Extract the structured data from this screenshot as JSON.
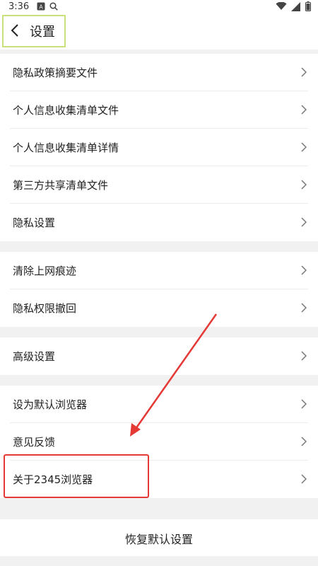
{
  "status_bar": {
    "time": "3:36",
    "icons": [
      "a-icon",
      "search-icon",
      "wifi-icon",
      "battery-icon"
    ]
  },
  "header": {
    "title": "设置",
    "back_icon": "chevron-left-icon",
    "highlight_color": "#c9e07e"
  },
  "groups": [
    {
      "items": [
        {
          "label": "隐私政策摘要文件"
        },
        {
          "label": "个人信息收集清单文件"
        },
        {
          "label": "个人信息收集清单详情"
        },
        {
          "label": "第三方共享清单文件"
        },
        {
          "label": "隐私设置"
        }
      ]
    },
    {
      "items": [
        {
          "label": "清除上网痕迹"
        },
        {
          "label": "隐私权限撤回"
        }
      ]
    },
    {
      "items": [
        {
          "label": "高级设置"
        }
      ]
    },
    {
      "items": [
        {
          "label": "设为默认浏览器"
        },
        {
          "label": "意见反馈"
        },
        {
          "label": "关于2345浏览器"
        }
      ]
    }
  ],
  "footer": {
    "restore_label": "恢复默认设置"
  },
  "annotation": {
    "color": "#e53935"
  }
}
